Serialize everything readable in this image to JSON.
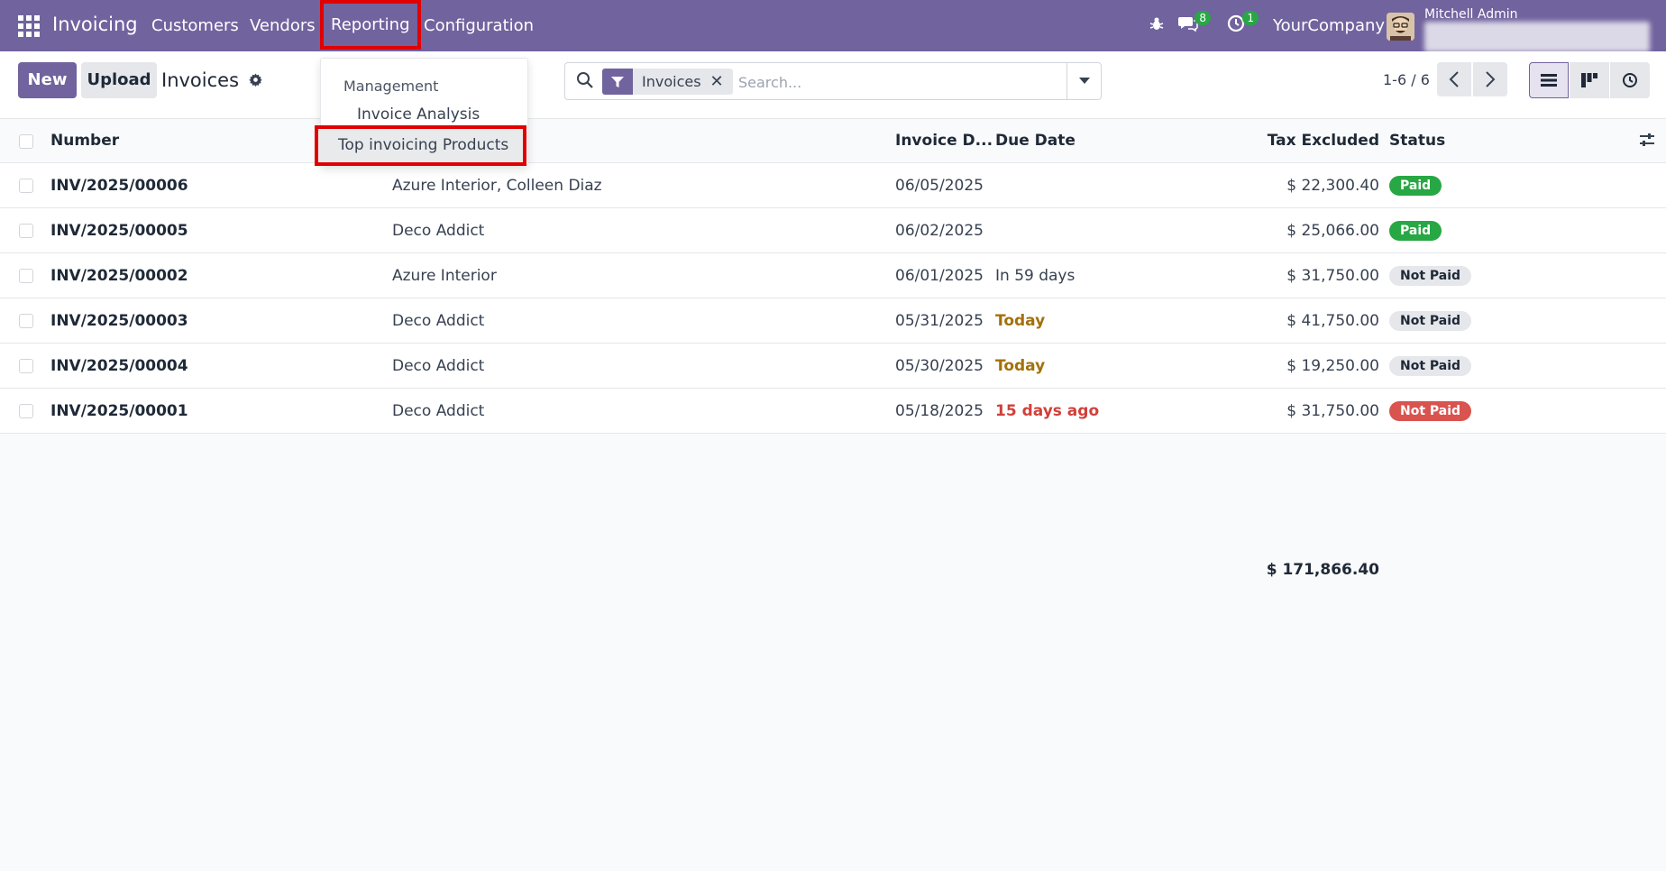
{
  "navbar": {
    "brand": "Invoicing",
    "menu": [
      "Customers",
      "Vendors",
      "Reporting",
      "Configuration"
    ],
    "messages_count": "8",
    "activities_count": "1",
    "company": "YourCompany",
    "user": "Mitchell Admin"
  },
  "control": {
    "new_label": "New",
    "upload_label": "Upload",
    "breadcrumb": "Invoices",
    "search": {
      "facet": "Invoices",
      "placeholder": "Search..."
    },
    "pager": "1-6 / 6"
  },
  "reporting_menu": {
    "section": "Management",
    "items": [
      "Invoice Analysis",
      "Top invoicing Products"
    ]
  },
  "table": {
    "columns": [
      "Number",
      "Invoice D...",
      "Due Date",
      "Tax Excluded",
      "Status"
    ],
    "rows": [
      {
        "number": "INV/2025/00006",
        "partner": "Azure Interior, Colleen Diaz",
        "date": "06/05/2025",
        "due": "",
        "due_state": "none",
        "tax": "$ 22,300.40",
        "status": "Paid",
        "status_type": "paid"
      },
      {
        "number": "INV/2025/00005",
        "partner": "Deco Addict",
        "date": "06/02/2025",
        "due": "",
        "due_state": "none",
        "tax": "$ 25,066.00",
        "status": "Paid",
        "status_type": "paid"
      },
      {
        "number": "INV/2025/00002",
        "partner": "Azure Interior",
        "date": "06/01/2025",
        "due": "In 59 days",
        "due_state": "normal",
        "tax": "$ 31,750.00",
        "status": "Not Paid",
        "status_type": "notpaid"
      },
      {
        "number": "INV/2025/00003",
        "partner": "Deco Addict",
        "date": "05/31/2025",
        "due": "Today",
        "due_state": "warn",
        "tax": "$ 41,750.00",
        "status": "Not Paid",
        "status_type": "notpaid"
      },
      {
        "number": "INV/2025/00004",
        "partner": "Deco Addict",
        "date": "05/30/2025",
        "due": "Today",
        "due_state": "warn",
        "tax": "$ 19,250.00",
        "status": "Not Paid",
        "status_type": "notpaid"
      },
      {
        "number": "INV/2025/00001",
        "partner": "Deco Addict",
        "date": "05/18/2025",
        "due": "15 days ago",
        "due_state": "late",
        "tax": "$ 31,750.00",
        "status": "Not Paid",
        "status_type": "late"
      }
    ],
    "total": "$ 171,866.40"
  },
  "colors": {
    "brand": "#71639e",
    "paid": "#28a745",
    "late": "#d9534f",
    "warn": "#a3700b",
    "highlight": "#e00000"
  }
}
